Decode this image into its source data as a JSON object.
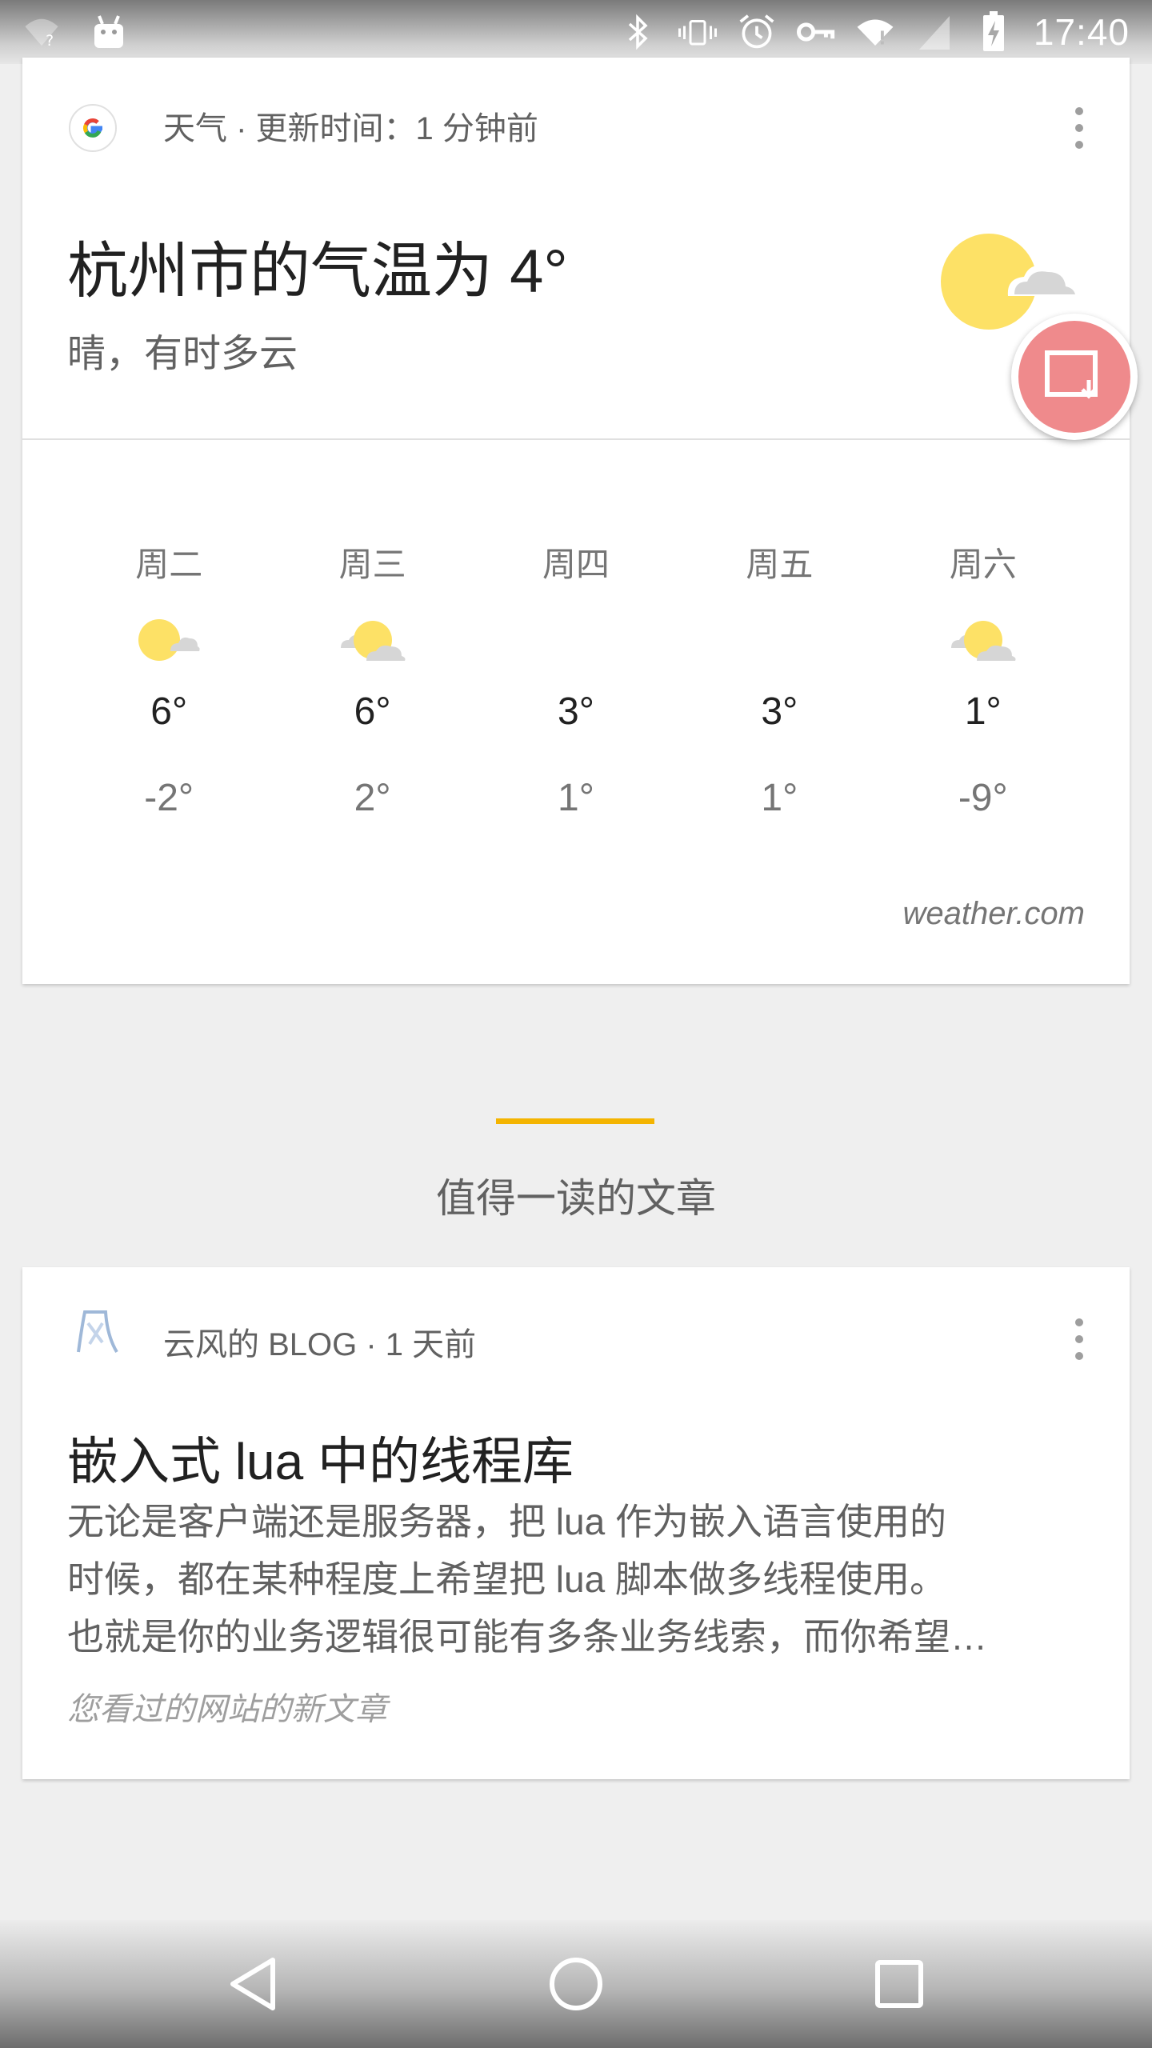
{
  "status_bar": {
    "time": "17:40",
    "icons": [
      "wifi-unknown-icon",
      "android-icon",
      "bluetooth-icon",
      "vibrate-icon",
      "alarm-icon",
      "vpn-key-icon",
      "wifi-icon",
      "signal-icon",
      "battery-charging-icon"
    ]
  },
  "weather_card": {
    "header": "天气 · 更新时间：1 分钟前",
    "title": "杭州市的气温为 4°",
    "condition": "晴，有时多云",
    "current_icon": "sun-cloud-icon",
    "forecast": [
      {
        "day": "周二",
        "icon": "sun-small-cloud-icon",
        "high": "6°",
        "low": "-2°"
      },
      {
        "day": "周三",
        "icon": "partly-cloudy-icon",
        "high": "6°",
        "low": "2°"
      },
      {
        "day": "周四",
        "icon": "",
        "high": "3°",
        "low": "1°"
      },
      {
        "day": "周五",
        "icon": "",
        "high": "3°",
        "low": "1°"
      },
      {
        "day": "周六",
        "icon": "partly-cloudy-icon",
        "high": "1°",
        "low": "-9°"
      }
    ],
    "source": "weather.com"
  },
  "section": {
    "title": "值得一读的文章",
    "accent_color": "#f4b400"
  },
  "article_card": {
    "header": "云风的 BLOG · 1 天前",
    "title": "嵌入式 lua 中的线程库",
    "body_lines": [
      "无论是客户端还是服务器，把 lua 作为嵌入语言使用的",
      "时候，都在某种程度上希望把 lua 脚本做多线程使用。",
      "也就是你的业务逻辑很可能有多条业务线索，而你希望…"
    ],
    "footer": "您看过的网站的新文章"
  },
  "fab": {
    "icon": "screenshot-icon",
    "color": "#ef8a8c"
  },
  "nav_bar": {
    "buttons": [
      "back-icon",
      "home-icon",
      "recents-icon"
    ]
  }
}
